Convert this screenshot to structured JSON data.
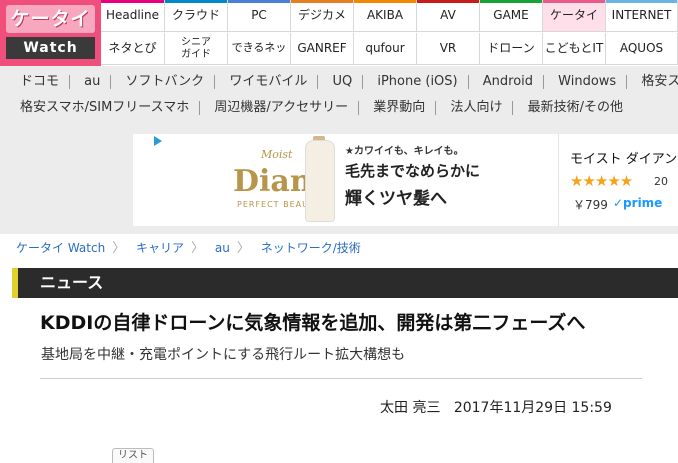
{
  "logo": {
    "top": "ケータイ",
    "bottom": "Watch"
  },
  "nav": [
    {
      "label": "Headline",
      "color": "#e6007e"
    },
    {
      "label": "クラウド",
      "color": "#0089c6"
    },
    {
      "label": "PC",
      "color": "#4a7fd6"
    },
    {
      "label": "デジカメ",
      "color": "#e67e22"
    },
    {
      "label": "AKIBA",
      "color": "#f08800"
    },
    {
      "label": "AV",
      "color": "#c81b1b"
    },
    {
      "label": "GAME",
      "color": "#17a336"
    },
    {
      "label": "ケータイ",
      "color": "#e95a8b"
    },
    {
      "label": "INTERNET",
      "color": "#6bb4e6"
    },
    {
      "label": "ネタとぴ",
      "color": ""
    },
    {
      "label": "シニアガイド",
      "line1": "シニア",
      "line2": "ガイド",
      "color": ""
    },
    {
      "label": "できるネット",
      "color": ""
    },
    {
      "label": "GANREF",
      "color": ""
    },
    {
      "label": "qufour",
      "color": ""
    },
    {
      "label": "VR",
      "color": ""
    },
    {
      "label": "ドローン",
      "color": ""
    },
    {
      "label": "こどもとIT",
      "color": ""
    },
    {
      "label": "AQUOS",
      "color": ""
    }
  ],
  "carriers_row1": [
    "ドコモ",
    "au",
    "ソフトバンク",
    "ワイモバイル",
    "UQ",
    "iPhone (iOS)",
    "Android",
    "Windows",
    "格安ス"
  ],
  "carriers_row2": [
    "格安スマホ/SIMフリースマホ",
    "周辺機器/アクセサリー",
    "業界動向",
    "法人向け",
    "最新技術/その他"
  ],
  "ad": {
    "brand": "Diane",
    "brand_sub": "PERFECT BEAUTY",
    "script": "Moist",
    "line1": "★カワイイも、キレイも。",
    "line2": "毛先までなめらかに",
    "line3": "輝くツヤ髪へ",
    "product": "モイスト ダイアン",
    "stars": "★★★★★",
    "reviews": "20",
    "price": "￥799",
    "prime": "✓prime"
  },
  "breadcrumb": [
    "ケータイ Watch",
    "キャリア",
    "au",
    "ネットワーク/技術"
  ],
  "section": "ニュース",
  "article": {
    "title": "KDDIの自律ドローンに気象情報を追加、開発は第二フェーズへ",
    "subtitle": "基地局を中継・充電ポイントにする飛行ルート拡大構想も",
    "author": "太田 亮三",
    "date": "2017年11月29日 15:59"
  },
  "list_tab": "リスト",
  "colors": {
    "logo": "#ef4f7a",
    "section_bar": "#2b2b2b",
    "section_accent": "#e0cf2d",
    "link": "#2b6cc4"
  }
}
